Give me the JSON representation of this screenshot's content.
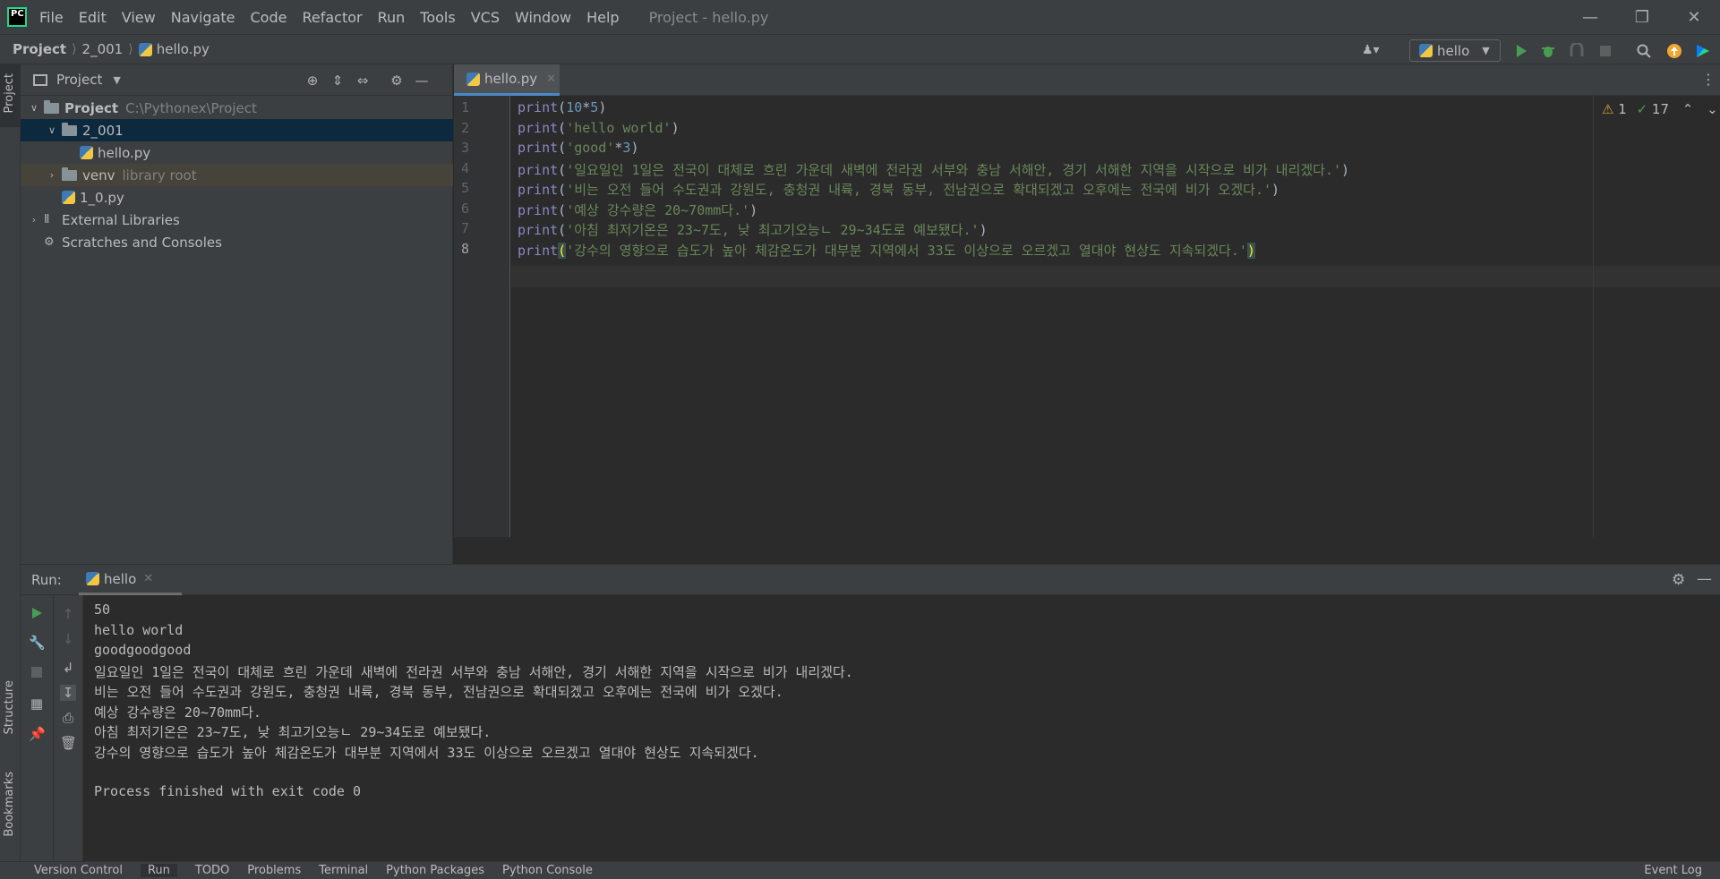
{
  "app": {
    "menu": [
      "File",
      "Edit",
      "View",
      "Navigate",
      "Code",
      "Refactor",
      "Run",
      "Tools",
      "VCS",
      "Window",
      "Help"
    ],
    "window_title": "Project - hello.py"
  },
  "breadcrumb": [
    "Project",
    "2_001",
    "hello.py"
  ],
  "toolbar": {
    "run_config": "hello"
  },
  "project_panel": {
    "title": "Project",
    "tree": [
      {
        "label": "Project",
        "note": "C:\\Pythonex\\Project",
        "indent": 0,
        "arrow": "open",
        "icon": "folder-icon"
      },
      {
        "label": "2_001",
        "note": "",
        "indent": 1,
        "arrow": "open",
        "icon": "folder-icon"
      },
      {
        "label": "hello.py",
        "note": "",
        "indent": 2,
        "arrow": "",
        "icon": "python-file-icon"
      },
      {
        "label": "venv",
        "note": "library root",
        "indent": 1,
        "arrow": "closed",
        "icon": "folder-icon"
      },
      {
        "label": "1_0.py",
        "note": "",
        "indent": 1,
        "arrow": "",
        "icon": "python-file-icon"
      },
      {
        "label": "External Libraries",
        "note": "",
        "indent": 0,
        "arrow": "closed",
        "icon": "library-icon"
      },
      {
        "label": "Scratches and Consoles",
        "note": "",
        "indent": 0,
        "arrow": "",
        "icon": "scratches-icon"
      }
    ]
  },
  "editor": {
    "tab": "hello.py",
    "warnings": "1",
    "ok_count": "17",
    "lines": [
      {
        "no": "1",
        "parts": [
          [
            "kw",
            "print"
          ],
          [
            "op",
            "("
          ],
          [
            "num",
            "10"
          ],
          [
            "op",
            "*"
          ],
          [
            "num",
            "5"
          ],
          [
            "op",
            ")"
          ]
        ]
      },
      {
        "no": "2",
        "parts": [
          [
            "kw",
            "print"
          ],
          [
            "op",
            "("
          ],
          [
            "str",
            "'hello world'"
          ],
          [
            "op",
            ")"
          ]
        ]
      },
      {
        "no": "3",
        "parts": [
          [
            "kw",
            "print"
          ],
          [
            "op",
            "("
          ],
          [
            "str",
            "'good'"
          ],
          [
            "op",
            "*"
          ],
          [
            "num",
            "3"
          ],
          [
            "op",
            ")"
          ]
        ]
      },
      {
        "no": "4",
        "parts": [
          [
            "kw",
            "print"
          ],
          [
            "op",
            "("
          ],
          [
            "str",
            "'일요일인 1일은 전국이 대체로 흐린 가운데 새벽에 전라권 서부와 충남 서해안, 경기 서해한 지역을 시작으로 비가 내리겠다.'"
          ],
          [
            "op",
            ")"
          ]
        ]
      },
      {
        "no": "5",
        "parts": [
          [
            "kw",
            "print"
          ],
          [
            "op",
            "("
          ],
          [
            "str",
            "'비는 오전 들어 수도권과 강원도, 충청권 내륙, 경북 동부, 전남권으로 확대되겠고 오후에는 전국에 비가 오겠다.'"
          ],
          [
            "op",
            ")"
          ]
        ]
      },
      {
        "no": "6",
        "parts": [
          [
            "kw",
            "print"
          ],
          [
            "op",
            "("
          ],
          [
            "str",
            "'예상 강수량은 20~70mm다.'"
          ],
          [
            "op",
            ")"
          ]
        ]
      },
      {
        "no": "7",
        "parts": [
          [
            "kw",
            "print"
          ],
          [
            "op",
            "("
          ],
          [
            "str",
            "'아침 최저기온은 23~7도, 낮 최고기오능ㄴ 29~34도로 예보됐다.'"
          ],
          [
            "op",
            ")"
          ]
        ]
      },
      {
        "no": "8",
        "parts": [
          [
            "kw",
            "print"
          ],
          [
            "bracket",
            "("
          ],
          [
            "str",
            "'강수의 영향으로 습도가 높아 체감온도가 대부분 지역에서 33도 이상으로 오르겠고 열대야 현상도 지속되겠다.'"
          ],
          [
            "bracket",
            ")"
          ]
        ]
      }
    ]
  },
  "run_panel": {
    "label": "Run:",
    "tab": "hello",
    "output": [
      "50",
      "hello world",
      "goodgoodgood",
      "일요일인 1일은 전국이 대체로 흐린 가운데 새벽에 전라권 서부와 충남 서해안, 경기 서해한 지역을 시작으로 비가 내리겠다.",
      "비는 오전 들어 수도권과 강원도, 충청권 내륙, 경북 동부, 전남권으로 확대되겠고 오후에는 전국에 비가 오겠다.",
      "예상 강수량은 20~70mm다.",
      "아침 최저기온은 23~7도, 낮 최고기오능ㄴ 29~34도로 예보됐다.",
      "강수의 영향으로 습도가 높아 체감온도가 대부분 지역에서 33도 이상으로 오르겠고 열대야 현상도 지속되겠다.",
      "",
      "Process finished with exit code 0"
    ]
  },
  "side_labels": {
    "project": "Project",
    "structure": "Structure",
    "bookmarks": "Bookmarks"
  },
  "bottom_bar": [
    "Version Control",
    "Run",
    "TODO",
    "Problems",
    "Terminal",
    "Python Packages",
    "Python Console",
    "Event Log"
  ],
  "colors": {
    "accent": "#4a88c7",
    "run_green": "#499c54"
  }
}
